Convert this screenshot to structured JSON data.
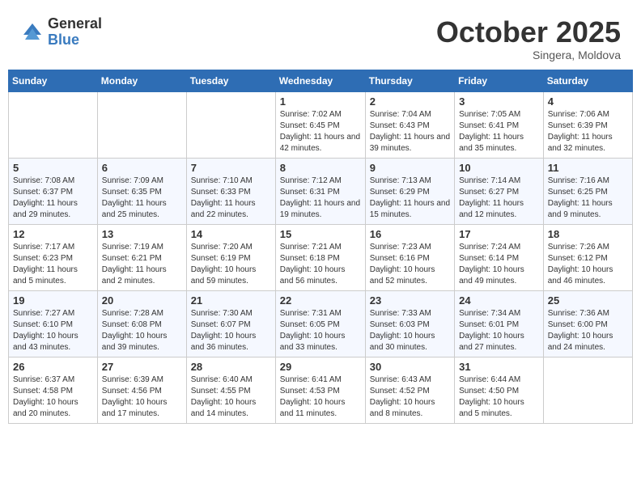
{
  "header": {
    "logo_general": "General",
    "logo_blue": "Blue",
    "month": "October 2025",
    "location": "Singera, Moldova"
  },
  "days_of_week": [
    "Sunday",
    "Monday",
    "Tuesday",
    "Wednesday",
    "Thursday",
    "Friday",
    "Saturday"
  ],
  "weeks": [
    [
      {
        "day": "",
        "info": ""
      },
      {
        "day": "",
        "info": ""
      },
      {
        "day": "",
        "info": ""
      },
      {
        "day": "1",
        "info": "Sunrise: 7:02 AM\nSunset: 6:45 PM\nDaylight: 11 hours and 42 minutes."
      },
      {
        "day": "2",
        "info": "Sunrise: 7:04 AM\nSunset: 6:43 PM\nDaylight: 11 hours and 39 minutes."
      },
      {
        "day": "3",
        "info": "Sunrise: 7:05 AM\nSunset: 6:41 PM\nDaylight: 11 hours and 35 minutes."
      },
      {
        "day": "4",
        "info": "Sunrise: 7:06 AM\nSunset: 6:39 PM\nDaylight: 11 hours and 32 minutes."
      }
    ],
    [
      {
        "day": "5",
        "info": "Sunrise: 7:08 AM\nSunset: 6:37 PM\nDaylight: 11 hours and 29 minutes."
      },
      {
        "day": "6",
        "info": "Sunrise: 7:09 AM\nSunset: 6:35 PM\nDaylight: 11 hours and 25 minutes."
      },
      {
        "day": "7",
        "info": "Sunrise: 7:10 AM\nSunset: 6:33 PM\nDaylight: 11 hours and 22 minutes."
      },
      {
        "day": "8",
        "info": "Sunrise: 7:12 AM\nSunset: 6:31 PM\nDaylight: 11 hours and 19 minutes."
      },
      {
        "day": "9",
        "info": "Sunrise: 7:13 AM\nSunset: 6:29 PM\nDaylight: 11 hours and 15 minutes."
      },
      {
        "day": "10",
        "info": "Sunrise: 7:14 AM\nSunset: 6:27 PM\nDaylight: 11 hours and 12 minutes."
      },
      {
        "day": "11",
        "info": "Sunrise: 7:16 AM\nSunset: 6:25 PM\nDaylight: 11 hours and 9 minutes."
      }
    ],
    [
      {
        "day": "12",
        "info": "Sunrise: 7:17 AM\nSunset: 6:23 PM\nDaylight: 11 hours and 5 minutes."
      },
      {
        "day": "13",
        "info": "Sunrise: 7:19 AM\nSunset: 6:21 PM\nDaylight: 11 hours and 2 minutes."
      },
      {
        "day": "14",
        "info": "Sunrise: 7:20 AM\nSunset: 6:19 PM\nDaylight: 10 hours and 59 minutes."
      },
      {
        "day": "15",
        "info": "Sunrise: 7:21 AM\nSunset: 6:18 PM\nDaylight: 10 hours and 56 minutes."
      },
      {
        "day": "16",
        "info": "Sunrise: 7:23 AM\nSunset: 6:16 PM\nDaylight: 10 hours and 52 minutes."
      },
      {
        "day": "17",
        "info": "Sunrise: 7:24 AM\nSunset: 6:14 PM\nDaylight: 10 hours and 49 minutes."
      },
      {
        "day": "18",
        "info": "Sunrise: 7:26 AM\nSunset: 6:12 PM\nDaylight: 10 hours and 46 minutes."
      }
    ],
    [
      {
        "day": "19",
        "info": "Sunrise: 7:27 AM\nSunset: 6:10 PM\nDaylight: 10 hours and 43 minutes."
      },
      {
        "day": "20",
        "info": "Sunrise: 7:28 AM\nSunset: 6:08 PM\nDaylight: 10 hours and 39 minutes."
      },
      {
        "day": "21",
        "info": "Sunrise: 7:30 AM\nSunset: 6:07 PM\nDaylight: 10 hours and 36 minutes."
      },
      {
        "day": "22",
        "info": "Sunrise: 7:31 AM\nSunset: 6:05 PM\nDaylight: 10 hours and 33 minutes."
      },
      {
        "day": "23",
        "info": "Sunrise: 7:33 AM\nSunset: 6:03 PM\nDaylight: 10 hours and 30 minutes."
      },
      {
        "day": "24",
        "info": "Sunrise: 7:34 AM\nSunset: 6:01 PM\nDaylight: 10 hours and 27 minutes."
      },
      {
        "day": "25",
        "info": "Sunrise: 7:36 AM\nSunset: 6:00 PM\nDaylight: 10 hours and 24 minutes."
      }
    ],
    [
      {
        "day": "26",
        "info": "Sunrise: 6:37 AM\nSunset: 4:58 PM\nDaylight: 10 hours and 20 minutes."
      },
      {
        "day": "27",
        "info": "Sunrise: 6:39 AM\nSunset: 4:56 PM\nDaylight: 10 hours and 17 minutes."
      },
      {
        "day": "28",
        "info": "Sunrise: 6:40 AM\nSunset: 4:55 PM\nDaylight: 10 hours and 14 minutes."
      },
      {
        "day": "29",
        "info": "Sunrise: 6:41 AM\nSunset: 4:53 PM\nDaylight: 10 hours and 11 minutes."
      },
      {
        "day": "30",
        "info": "Sunrise: 6:43 AM\nSunset: 4:52 PM\nDaylight: 10 hours and 8 minutes."
      },
      {
        "day": "31",
        "info": "Sunrise: 6:44 AM\nSunset: 4:50 PM\nDaylight: 10 hours and 5 minutes."
      },
      {
        "day": "",
        "info": ""
      }
    ]
  ]
}
